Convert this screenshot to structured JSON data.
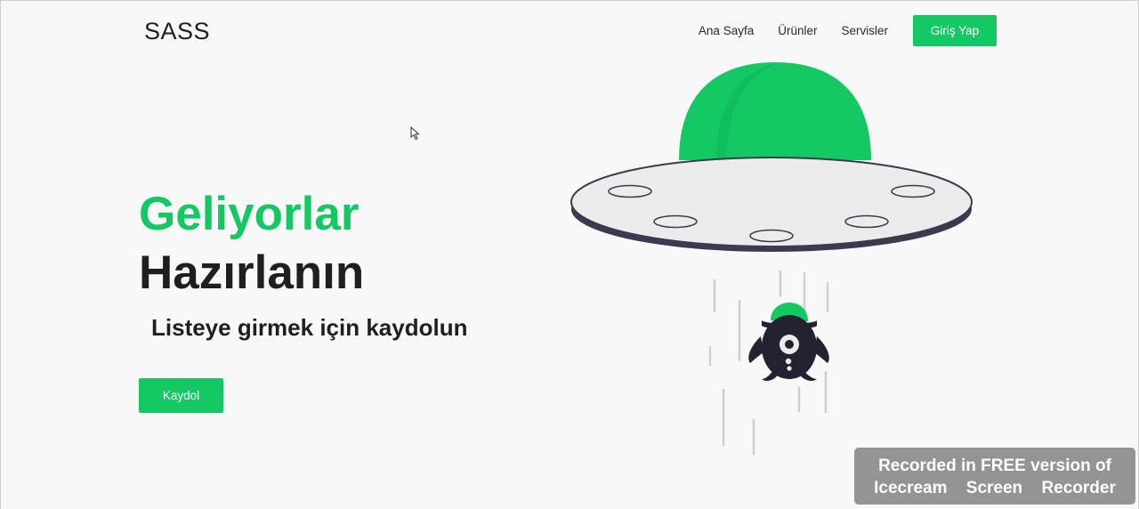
{
  "header": {
    "logo": "SASS",
    "nav": [
      {
        "label": "Ana Sayfa"
      },
      {
        "label": "Ürünler"
      },
      {
        "label": "Servisler"
      }
    ],
    "login_label": "Giriş Yap"
  },
  "hero": {
    "title_line1": "Geliyorlar",
    "title_line2": "Hazırlanın",
    "subtitle": "Listeye girmek için kaydolun",
    "signup_label": "Kaydol"
  },
  "colors": {
    "accent": "#14c864",
    "dark": "#1f1f1f",
    "ufo_body": "#ececec",
    "ufo_rim": "#3b3a4f"
  },
  "watermark": {
    "line1": "Recorded in FREE version of",
    "line2": "Icecream Screen Recorder"
  },
  "illustration": {
    "icon": "ufo-alien-illustration-icon"
  }
}
